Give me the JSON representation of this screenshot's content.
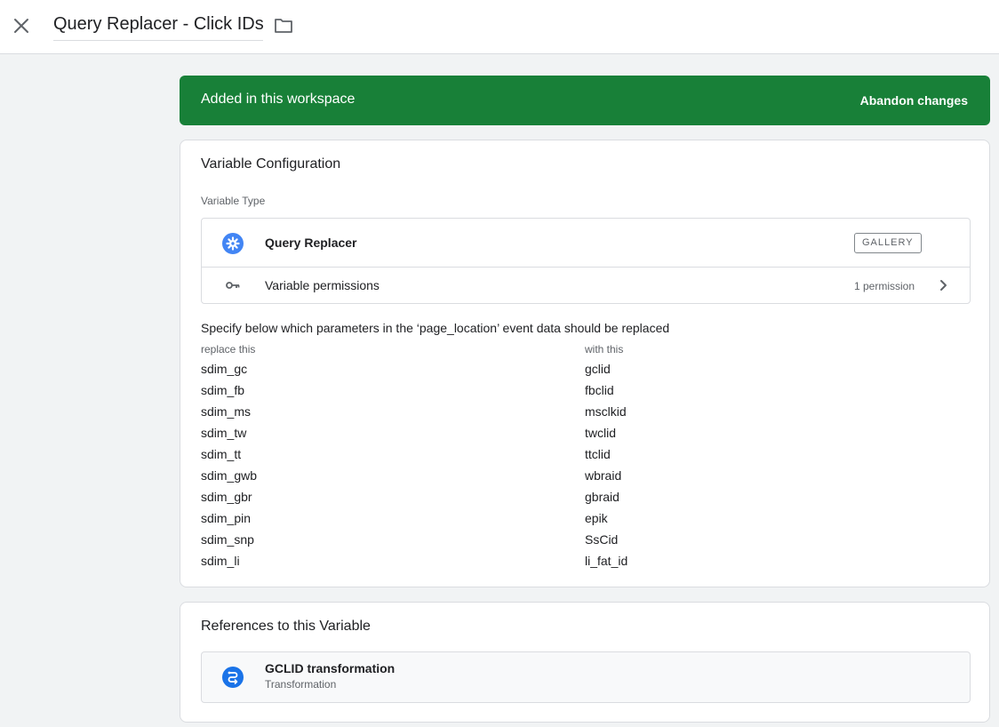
{
  "header": {
    "title": "Query Replacer - Click IDs",
    "close_icon": "close-icon",
    "folder_icon": "folder-icon"
  },
  "banner": {
    "text": "Added in this workspace",
    "action": "Abandon changes",
    "color": "#188038"
  },
  "config": {
    "title": "Variable Configuration",
    "type_label": "Variable Type",
    "type": {
      "icon": "gear-icon",
      "name": "Query Replacer",
      "badge": "GALLERY"
    },
    "permissions": {
      "icon": "key-icon",
      "label": "Variable permissions",
      "count": "1 permission"
    },
    "description": "Specify below which parameters in the ‘page_location’ event data should be replaced",
    "columns": [
      "replace this",
      "with this"
    ],
    "rows": [
      [
        "sdim_gc",
        "gclid"
      ],
      [
        "sdim_fb",
        "fbclid"
      ],
      [
        "sdim_ms",
        "msclkid"
      ],
      [
        "sdim_tw",
        "twclid"
      ],
      [
        "sdim_tt",
        "ttclid"
      ],
      [
        "sdim_gwb",
        "wbraid"
      ],
      [
        "sdim_gbr",
        "gbraid"
      ],
      [
        "sdim_pin",
        "epik"
      ],
      [
        "sdim_snp",
        "SsCid"
      ],
      [
        "sdim_li",
        "li_fat_id"
      ]
    ]
  },
  "references": {
    "title": "References to this Variable",
    "items": [
      {
        "icon": "transformation-icon",
        "name": "GCLID transformation",
        "type": "Transformation"
      }
    ]
  },
  "colors": {
    "accent": "#1a73e8",
    "success": "#188038"
  }
}
